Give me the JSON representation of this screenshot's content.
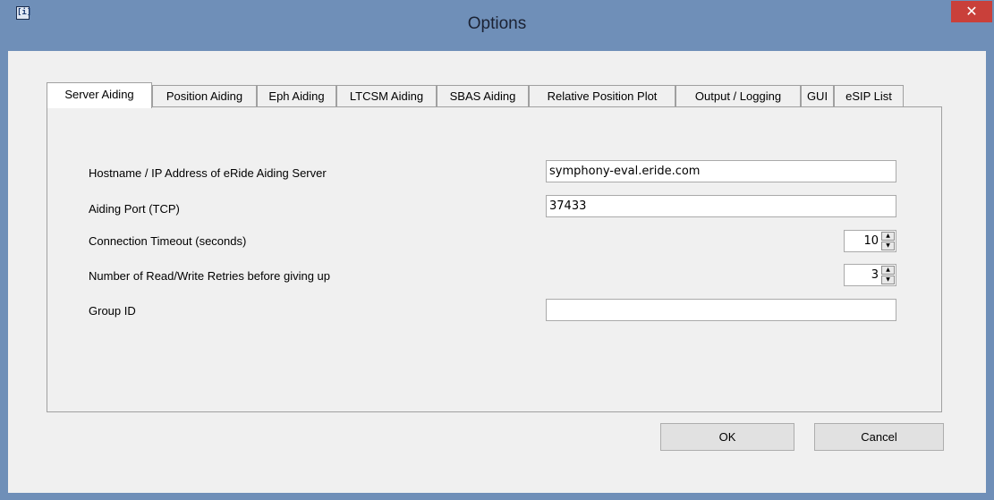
{
  "window": {
    "title": "Options",
    "app_icon_glyph": "[i]",
    "close_glyph": "✕"
  },
  "tabs": [
    {
      "label": "Server Aiding",
      "active": true
    },
    {
      "label": "Position Aiding",
      "active": false
    },
    {
      "label": "Eph Aiding",
      "active": false
    },
    {
      "label": "LTCSM Aiding",
      "active": false
    },
    {
      "label": "SBAS Aiding",
      "active": false
    },
    {
      "label": "Relative Position Plot",
      "active": false
    },
    {
      "label": "Output / Logging",
      "active": false
    },
    {
      "label": "GUI",
      "active": false
    },
    {
      "label": "eSIP List",
      "active": false
    }
  ],
  "form": {
    "hostname_label": "Hostname / IP Address of eRide Aiding Server",
    "hostname_value": "symphony-eval.eride.com",
    "port_label": "Aiding Port (TCP)",
    "port_value": "37433",
    "timeout_label": "Connection Timeout (seconds)",
    "timeout_value": "10",
    "retries_label": "Number of Read/Write Retries before giving up",
    "retries_value": "3",
    "group_label": "Group ID",
    "group_value": ""
  },
  "buttons": {
    "ok": "OK",
    "cancel": "Cancel"
  },
  "colors": {
    "title_bar": "#6f8fb8",
    "close_button": "#c9403a",
    "dialog_background": "#f0f0f0"
  }
}
